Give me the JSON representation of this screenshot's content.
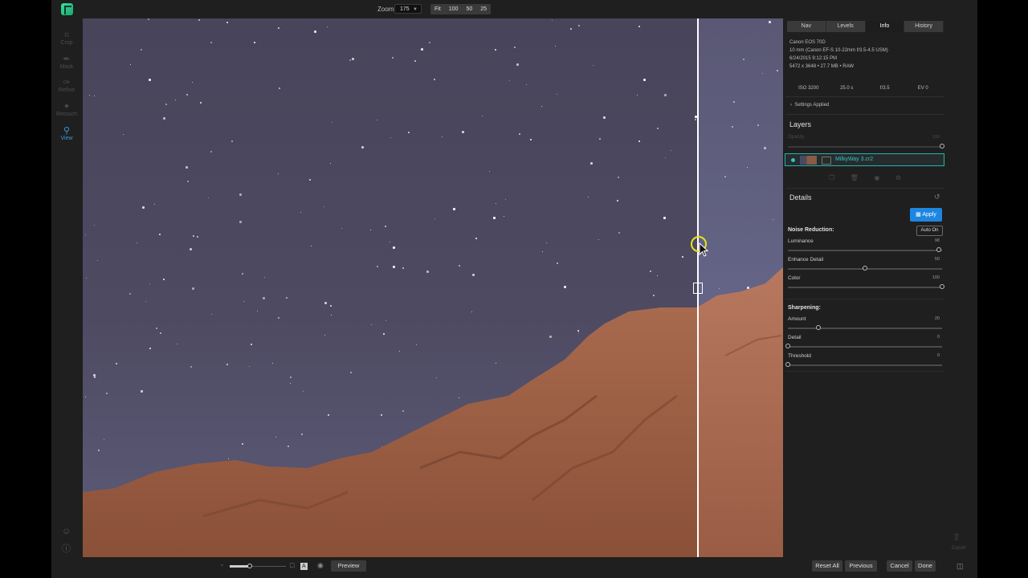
{
  "topbar": {
    "zoom_label": "Zoom",
    "zoom_value": "175",
    "zoom_presets": [
      "Fit",
      "100",
      "50",
      "25"
    ]
  },
  "tools": [
    {
      "label": "Crop",
      "icon": "crop-icon",
      "active": false
    },
    {
      "label": "Mask",
      "icon": "brush-icon",
      "active": false
    },
    {
      "label": "Refine",
      "icon": "refine-brush-icon",
      "active": false
    },
    {
      "label": "Retouch",
      "icon": "retouch-icon",
      "active": false
    },
    {
      "label": "View",
      "icon": "view-icon",
      "active": true
    }
  ],
  "panel": {
    "tabs": [
      "Nav",
      "Levels",
      "Info",
      "History"
    ],
    "active_tab": "Info",
    "info": {
      "camera": "Canon EOS 70D",
      "lens": "10 mm (Canon EF-S 10-22mm f/3.5-4.5 USM)",
      "datetime": "6/24/2015 9:12:15 PM",
      "file": "5472 x 3648  •  27.7 MB  •  RAW",
      "iso": "ISO 3200",
      "shutter": "25.0 s",
      "aperture": "f/3.5",
      "ev": "EV 0"
    },
    "settings_applied": "Settings Applied",
    "layers": {
      "title": "Layers",
      "opacity_label": "Opacity",
      "opacity_value": "100",
      "opacity": 100,
      "layer_name": "MilkyWay 3.cr2"
    },
    "details": {
      "title": "Details",
      "apply_label": "Apply",
      "auto_label": "Auto On",
      "noise_title": "Noise Reduction:",
      "luminance": {
        "label": "Luminance",
        "value": "98",
        "level": 98
      },
      "enhance": {
        "label": "Enhance Detail",
        "value": "50",
        "level": 50
      },
      "color": {
        "label": "Color",
        "value": "100",
        "level": 100
      },
      "sharpen_title": "Sharpening:",
      "amount": {
        "label": "Amount",
        "value": "20",
        "level": 20
      },
      "detail": {
        "label": "Detail",
        "value": "0",
        "level": 0
      },
      "threshold": {
        "label": "Threshold",
        "value": "0",
        "level": 0
      }
    }
  },
  "bottom": {
    "preview_label": "Preview",
    "zoom_slider_level": 0.5,
    "reset_all": "Reset All",
    "previous": "Previous",
    "cancel": "Cancel",
    "done": "Done",
    "export_label": "Export"
  },
  "colors": {
    "accent": "#1d86e0",
    "layer_highlight": "#1fb4b4",
    "cursor_ring": "#e4e41a"
  }
}
